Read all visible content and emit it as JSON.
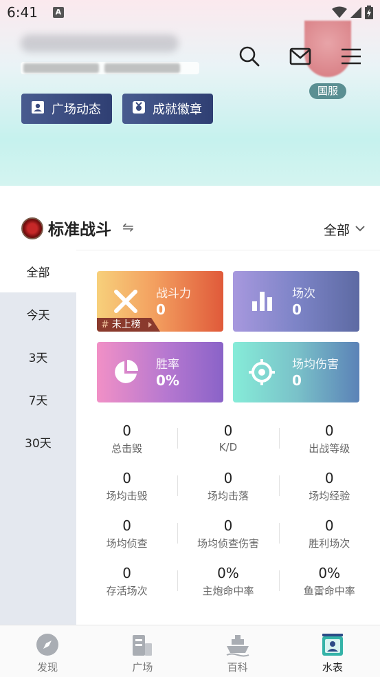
{
  "status_bar": {
    "time": "6:41",
    "badge": "A"
  },
  "profile": {
    "region": "国服"
  },
  "header_buttons": {
    "plaza": "广场动态",
    "achievement": "成就徽章"
  },
  "section": {
    "title": "标准战斗",
    "swap_icon": "⇋",
    "filter_value": "全部"
  },
  "time_filters": [
    "全部",
    "今天",
    "3天",
    "7天",
    "30天"
  ],
  "cards": {
    "power": {
      "label": "战斗力",
      "value": "0",
      "rank_hash": "#",
      "rank_text": "未上榜"
    },
    "battles": {
      "label": "场次",
      "value": "0"
    },
    "winrate": {
      "label": "胜率",
      "value": "0%"
    },
    "avg_damage": {
      "label": "场均伤害",
      "value": "0"
    }
  },
  "stats": [
    [
      {
        "value": "0",
        "label": "总击毁"
      },
      {
        "value": "0",
        "label": "K/D"
      },
      {
        "value": "0",
        "label": "出战等级"
      }
    ],
    [
      {
        "value": "0",
        "label": "场均击毁"
      },
      {
        "value": "0",
        "label": "场均击落"
      },
      {
        "value": "0",
        "label": "场均经验"
      }
    ],
    [
      {
        "value": "0",
        "label": "场均侦查"
      },
      {
        "value": "0",
        "label": "场均侦查伤害"
      },
      {
        "value": "0",
        "label": "胜利场次"
      }
    ],
    [
      {
        "value": "0",
        "label": "存活场次"
      },
      {
        "value": "0%",
        "label": "主炮命中率"
      },
      {
        "value": "0%",
        "label": "鱼雷命中率"
      }
    ]
  ],
  "bottom_nav": [
    {
      "label": "发现",
      "icon": "compass-icon"
    },
    {
      "label": "广场",
      "icon": "building-icon"
    },
    {
      "label": "百科",
      "icon": "ship-icon"
    },
    {
      "label": "水表",
      "icon": "profile-card-icon"
    }
  ],
  "colors": {
    "accent_dark": "#2f3f73",
    "menu_bg": "#e4e8ef"
  }
}
